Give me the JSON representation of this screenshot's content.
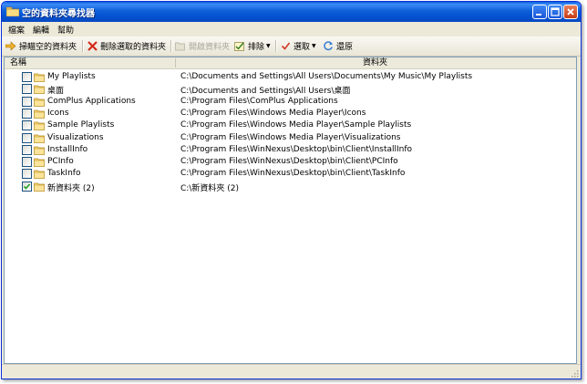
{
  "window": {
    "title": "空的資料夾尋找器",
    "icons": {
      "app": "folder-app-icon",
      "minimize": "minimize-icon",
      "maximize": "maximize-icon",
      "close": "close-icon"
    }
  },
  "menu": [
    "檔案",
    "編輯",
    "幫助"
  ],
  "toolbar": {
    "scan": {
      "label": "掃瞄空的資料夾",
      "icon": "arrow-right-icon"
    },
    "delete": {
      "label": "刪除選取的資料夾",
      "icon": "red-x-icon"
    },
    "open": {
      "label": "開啟資料夾",
      "icon": "folder-open-icon",
      "disabled": true
    },
    "exclude": {
      "label": "排除",
      "icon": "exclude-icon"
    },
    "select": {
      "label": "選取",
      "icon": "checkmark-icon"
    },
    "restore": {
      "label": "還原",
      "icon": "refresh-icon"
    }
  },
  "list": {
    "columns": [
      "名稱",
      "資料夾"
    ],
    "rows": [
      {
        "name": "My Playlists",
        "path": "C:\\Documents and Settings\\All Users\\Documents\\My Music\\My Playlists",
        "checked": false
      },
      {
        "name": "桌面",
        "path": "C:\\Documents and Settings\\All Users\\桌面",
        "checked": false
      },
      {
        "name": "ComPlus Applications",
        "path": "C:\\Program Files\\ComPlus Applications",
        "checked": false
      },
      {
        "name": "Icons",
        "path": "C:\\Program Files\\Windows Media Player\\Icons",
        "checked": false
      },
      {
        "name": "Sample Playlists",
        "path": "C:\\Program Files\\Windows Media Player\\Sample Playlists",
        "checked": false
      },
      {
        "name": "Visualizations",
        "path": "C:\\Program Files\\Windows Media Player\\Visualizations",
        "checked": false
      },
      {
        "name": "InstallInfo",
        "path": "C:\\Program Files\\WinNexus\\Desktop\\bin\\Client\\InstallInfo",
        "checked": false
      },
      {
        "name": "PCInfo",
        "path": "C:\\Program Files\\WinNexus\\Desktop\\bin\\Client\\PCInfo",
        "checked": false
      },
      {
        "name": "TaskInfo",
        "path": "C:\\Program Files\\WinNexus\\Desktop\\bin\\Client\\TaskInfo",
        "checked": false
      },
      {
        "name": "新資料夾 (2)",
        "path": "C:\\新資料夾 (2)",
        "checked": true
      }
    ]
  },
  "colors": {
    "titlebar": "#0553d2",
    "window_border": "#0831d9",
    "chrome": "#ece9d8",
    "list_border": "#7f9db9"
  }
}
